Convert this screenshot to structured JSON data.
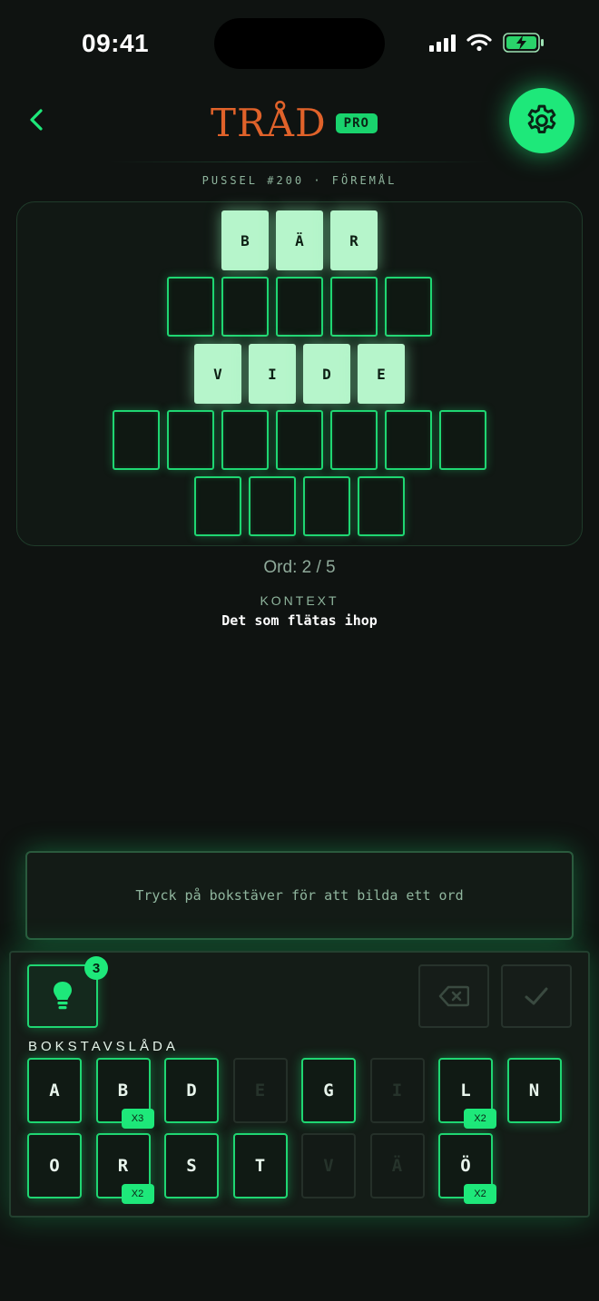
{
  "status_bar": {
    "time": "09:41"
  },
  "header": {
    "logo": "TRÅD",
    "badge": "PRO"
  },
  "subtitle": "PUSSEL #200 · FÖREMÅL",
  "board": {
    "rows": [
      [
        "B",
        "Ä",
        "R"
      ],
      [
        "",
        "",
        "",
        "",
        ""
      ],
      [
        "V",
        "I",
        "D",
        "E"
      ],
      [
        "",
        "",
        "",
        "",
        "",
        "",
        ""
      ],
      [
        "",
        "",
        "",
        ""
      ]
    ]
  },
  "progress": {
    "word_count": "Ord: 2 / 5"
  },
  "context": {
    "label": "KONTEXT",
    "text": "Det som flätas ihop"
  },
  "input": {
    "placeholder": "Tryck på bokstäver för att bilda ett ord"
  },
  "hint": {
    "count": "3"
  },
  "letterbox": {
    "label": "BOKSTAVSLÅDA",
    "keys": [
      {
        "letter": "A",
        "active": true
      },
      {
        "letter": "B",
        "active": true,
        "count": "X3"
      },
      {
        "letter": "D",
        "active": true
      },
      {
        "letter": "E",
        "active": false
      },
      {
        "letter": "G",
        "active": true
      },
      {
        "letter": "I",
        "active": false
      },
      {
        "letter": "L",
        "active": true,
        "count": "X2"
      },
      {
        "letter": "N",
        "active": true
      },
      {
        "letter": "O",
        "active": true
      },
      {
        "letter": "R",
        "active": true,
        "count": "X2"
      },
      {
        "letter": "S",
        "active": true
      },
      {
        "letter": "T",
        "active": true
      },
      {
        "letter": "V",
        "active": false
      },
      {
        "letter": "Ä",
        "active": false
      },
      {
        "letter": "Ö",
        "active": true,
        "count": "X2"
      }
    ]
  },
  "colors": {
    "accent": "#1ee87a",
    "logo": "#e0622a",
    "filled_tile": "#b6f5cb",
    "background": "#0f1311"
  }
}
